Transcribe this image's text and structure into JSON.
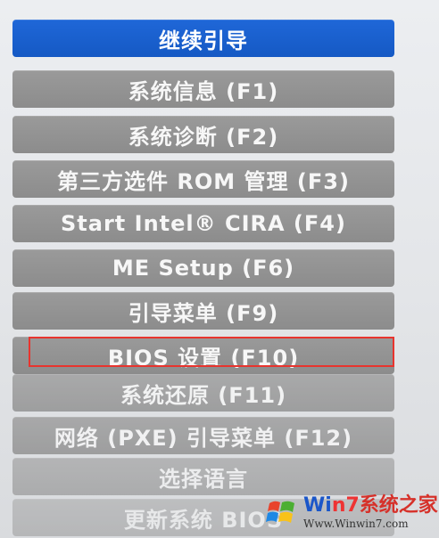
{
  "menu": {
    "items": [
      {
        "label": "继续引导"
      },
      {
        "label": "系统信息 (F1)"
      },
      {
        "label": "系统诊断 (F2)"
      },
      {
        "label": "第三方选件 ROM 管理 (F3)"
      },
      {
        "label": "Start Intel® CIRA (F4)"
      },
      {
        "label": "ME Setup (F6)"
      },
      {
        "label": "引导菜单 (F9)"
      },
      {
        "label": "BIOS 设置 (F10)"
      },
      {
        "label": "系统还原 (F11)"
      },
      {
        "label": "网络 (PXE) 引导菜单 (F12)"
      },
      {
        "label": "选择语言"
      },
      {
        "label": "更新系统 BIOS"
      }
    ]
  },
  "watermark": {
    "brand_win": "Wi",
    "brand_n": "n",
    "brand_7": "7",
    "brand_cn": "系统之家",
    "url": "Www.Winwin7.com"
  },
  "colors": {
    "selected": "#1f67d8",
    "item": "#8c8c8c",
    "highlight": "#e8342e"
  }
}
